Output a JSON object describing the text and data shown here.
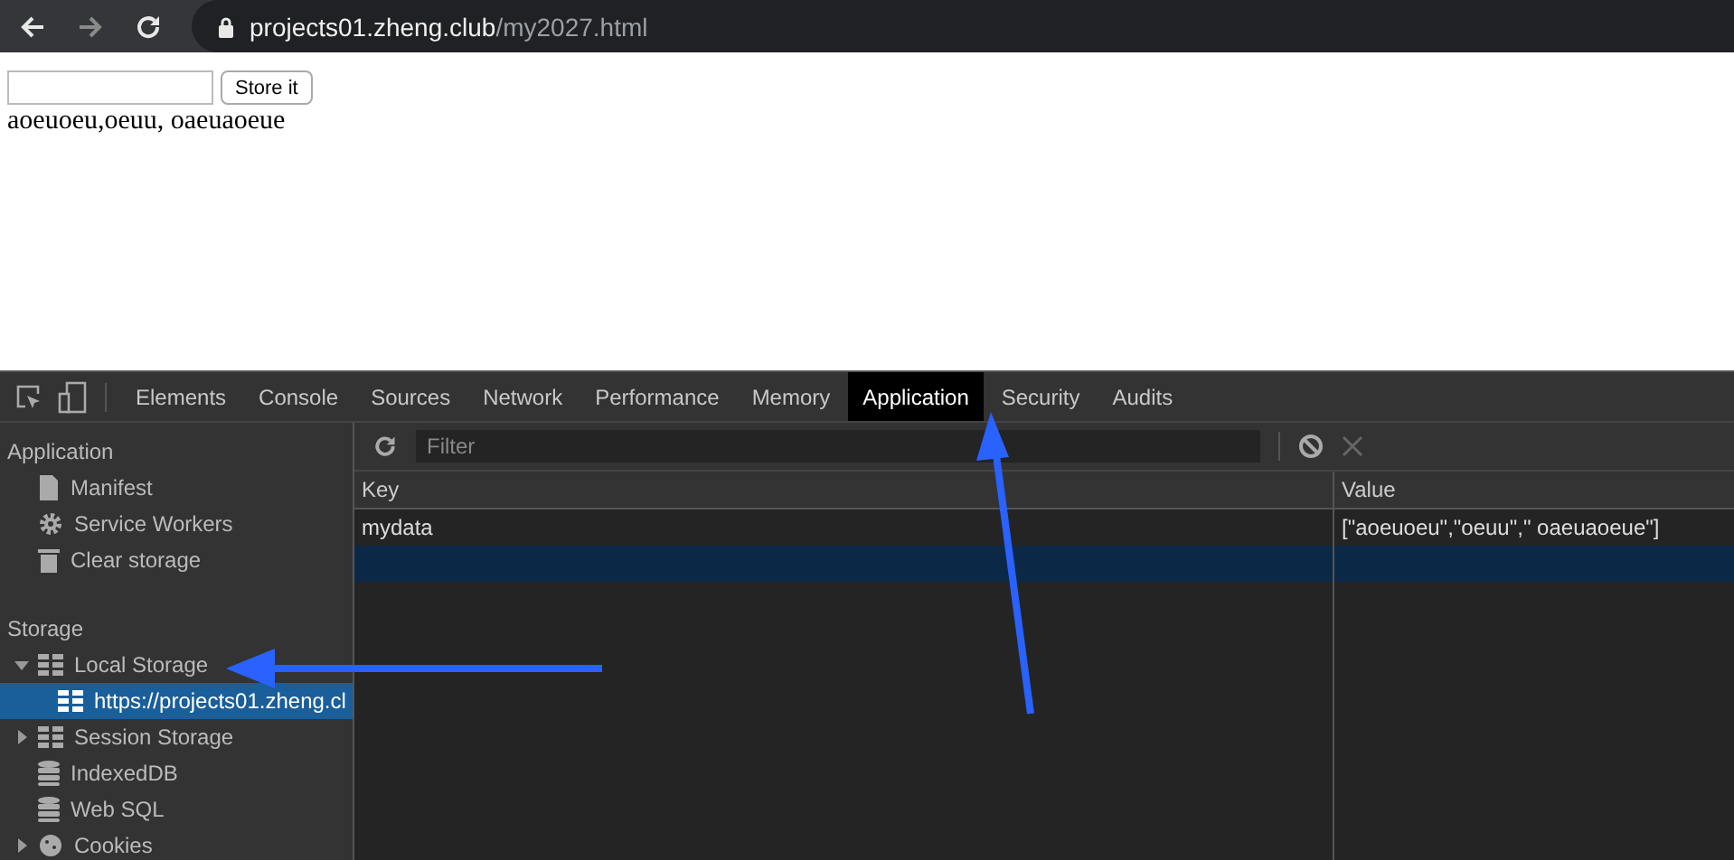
{
  "browser": {
    "url_host": "projects01.zheng.club",
    "url_path": "/my2027.html"
  },
  "page": {
    "button": "Store it",
    "output": "aoeuoeu,oeuu, oaeuaoeue"
  },
  "devtools": {
    "tabs": [
      {
        "label": "Elements",
        "selected": false
      },
      {
        "label": "Console",
        "selected": false
      },
      {
        "label": "Sources",
        "selected": false
      },
      {
        "label": "Network",
        "selected": false
      },
      {
        "label": "Performance",
        "selected": false
      },
      {
        "label": "Memory",
        "selected": false
      },
      {
        "label": "Application",
        "selected": true
      },
      {
        "label": "Security",
        "selected": false
      },
      {
        "label": "Audits",
        "selected": false
      }
    ],
    "sidebar": [
      {
        "title": "Application",
        "items": [
          {
            "label": "Manifest",
            "kind": "file",
            "selected": false
          },
          {
            "label": "Service Workers",
            "kind": "gear",
            "selected": false
          },
          {
            "label": "Clear storage",
            "kind": "trash",
            "selected": false
          }
        ]
      },
      {
        "title": "Storage",
        "items": [
          {
            "label": "Local Storage",
            "kind": "grid",
            "selected": false,
            "expanded": true,
            "children": [
              {
                "label": "https://projects01.zheng.cl",
                "kind": "grid",
                "selected": true
              }
            ]
          },
          {
            "label": "Session Storage",
            "kind": "grid",
            "selected": false,
            "expanded": false
          },
          {
            "label": "IndexedDB",
            "kind": "database",
            "selected": false
          },
          {
            "label": "Web SQL",
            "kind": "database",
            "selected": false
          },
          {
            "label": "Cookies",
            "kind": "cookie",
            "selected": false,
            "expanded": false
          }
        ]
      }
    ],
    "filter": {
      "placeholder": "Filter"
    },
    "table": {
      "columns": [
        "Key",
        "Value"
      ],
      "rows": [
        {
          "key": "mydata",
          "value": "[\"aoeuoeu\",\"oeuu\",\" oaeuaoeue\"]",
          "selected": false
        },
        {
          "selected": true
        }
      ]
    }
  }
}
